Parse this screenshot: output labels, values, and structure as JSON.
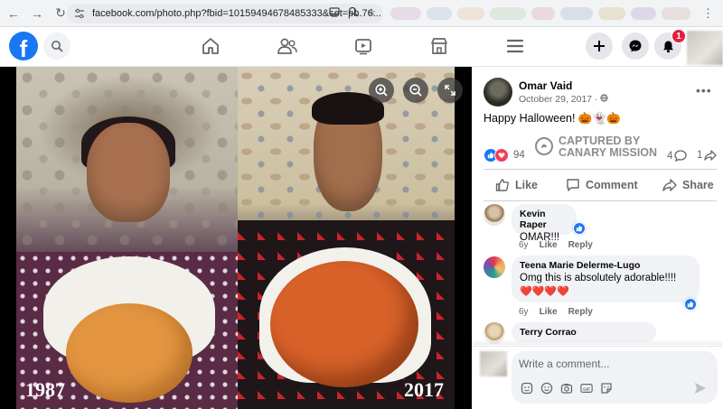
{
  "browser": {
    "url": "facebook.com/photo.php?fbid=10159494678485333&set=pb.76..."
  },
  "header": {
    "notification_count": "1",
    "colors": {
      "brand": "#1877f2",
      "badge": "#e41e3f"
    },
    "nav_icons": [
      "home-icon",
      "friends-icon",
      "watch-icon",
      "marketplace-icon",
      "menu-icon"
    ],
    "actions": [
      "create-icon",
      "messenger-icon",
      "notifications-icon"
    ]
  },
  "photo": {
    "left_year": "1987",
    "right_year": "2017",
    "controls": [
      "zoom-in-icon",
      "zoom-out-icon",
      "fullscreen-icon"
    ]
  },
  "post": {
    "author": "Omar Vaid",
    "date": "October 29, 2017 ·",
    "text": "Happy Halloween! 🎃👻🎃",
    "reaction_count": "94",
    "comment_count": "4",
    "share_count": "1",
    "watermark": "CAPTURED BY CANARY MISSION",
    "actions": {
      "like": "Like",
      "comment": "Comment",
      "share": "Share"
    }
  },
  "comments": [
    {
      "name": "Kevin Raper",
      "text": "OMAR!!!",
      "age": "6y",
      "like": "Like",
      "reply": "Reply"
    },
    {
      "name": "Teena Marie Delerme-Lugo",
      "text": "Omg this is absolutely adorable!!!!",
      "emoji": "❤️❤️❤️❤️",
      "age": "6y",
      "like": "Like",
      "reply": "Reply"
    },
    {
      "name": "Terry Corrao"
    }
  ],
  "composer": {
    "placeholder": "Write a comment..."
  }
}
